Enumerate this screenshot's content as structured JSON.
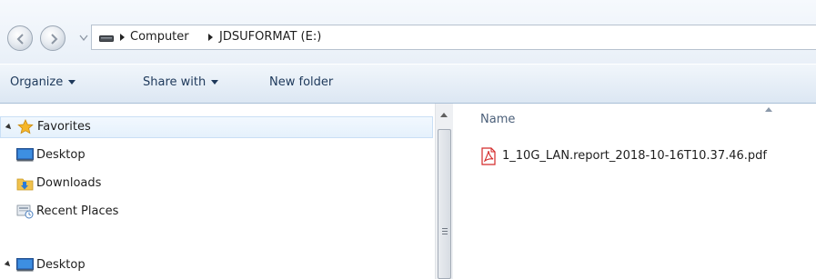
{
  "address_bar": {
    "breadcrumbs": [
      {
        "label": "Computer"
      },
      {
        "label": "JDSUFORMAT (E:)"
      }
    ],
    "icons": {
      "back": "back-arrow-icon",
      "forward": "forward-arrow-icon",
      "drive": "drive-icon"
    }
  },
  "command_bar": {
    "organize_label": "Organize",
    "share_label": "Share with",
    "new_folder_label": "New folder"
  },
  "nav_pane": {
    "favorites": {
      "label": "Favorites",
      "icon": "star-icon"
    },
    "items": [
      {
        "label": "Desktop",
        "icon": "desktop-icon"
      },
      {
        "label": "Downloads",
        "icon": "downloads-folder-icon"
      },
      {
        "label": "Recent Places",
        "icon": "recent-places-icon"
      }
    ],
    "desktop_root": {
      "label": "Desktop",
      "icon": "desktop-icon"
    }
  },
  "file_list": {
    "column_name": "Name",
    "files": [
      {
        "name": "1_10G_LAN.report_2018-10-16T10.37.46.pdf",
        "icon": "pdf-icon"
      }
    ]
  },
  "colors": {
    "accent": "#1e395b",
    "selection": "#e5f1fc",
    "star": "#f5b62a",
    "pdf": "#d42a2a"
  }
}
